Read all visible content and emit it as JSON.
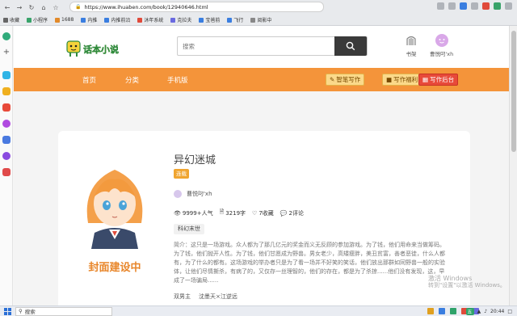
{
  "browser": {
    "url": "https://www.ihuaben.com/book/12940646.html",
    "bookmarks": [
      "收藏",
      "小程序",
      "1688",
      "内推",
      "内推前沿",
      "沐年系统",
      "克拉夫",
      "宝爸前",
      "飞行",
      "阅影中"
    ]
  },
  "header": {
    "logo_text": "话本小说",
    "search_placeholder": "搜索",
    "bookshelf_label": "书架",
    "user_label": "曹悦叼'xh"
  },
  "nav": {
    "items": [
      "首页",
      "分类",
      "手机版"
    ],
    "smart_write": "智笔写作",
    "write_welfare": "写作福利",
    "write_admin": "写作后台"
  },
  "book": {
    "cover_text": "封面建设中",
    "title": "异幻迷城",
    "badge": "连载",
    "author": "曹悦叼'xh",
    "popularity": "9999+人气",
    "words": "3219字",
    "favorites": "7收藏",
    "comments": "2评论",
    "genre": "科幻末世",
    "intro": "简介：这只是一场游戏。众人都为了那几亿元的奖金而义无反顾的参加游戏。为了钱，他们用命来当做筹码。为了钱，他们抛开人性。为了钱，他们甘愿成为野兽。男女老少，高矮瘦胖，美丑贫富，善者恶徒，什么人都有，为了什么的都有。这场游戏的举办者只是为了看一场并不好笑的笑话，他们放出那群如同野兽一般的实验体，让他们尽情撕杀，有病了的，又仅存一丝理智的，他们的存在，都是为了杀掠......他们没有发现，这，早成了一场骗局......",
    "pairings": [
      "双男主",
      "沈墨天×江逆远"
    ]
  },
  "watermark": {
    "line1": "激活 Windows",
    "line2": "转到\"设置\"以激活 Windows。"
  },
  "taskbar": {
    "search_label": "搜索",
    "time": "20:44",
    "ime": "五"
  }
}
